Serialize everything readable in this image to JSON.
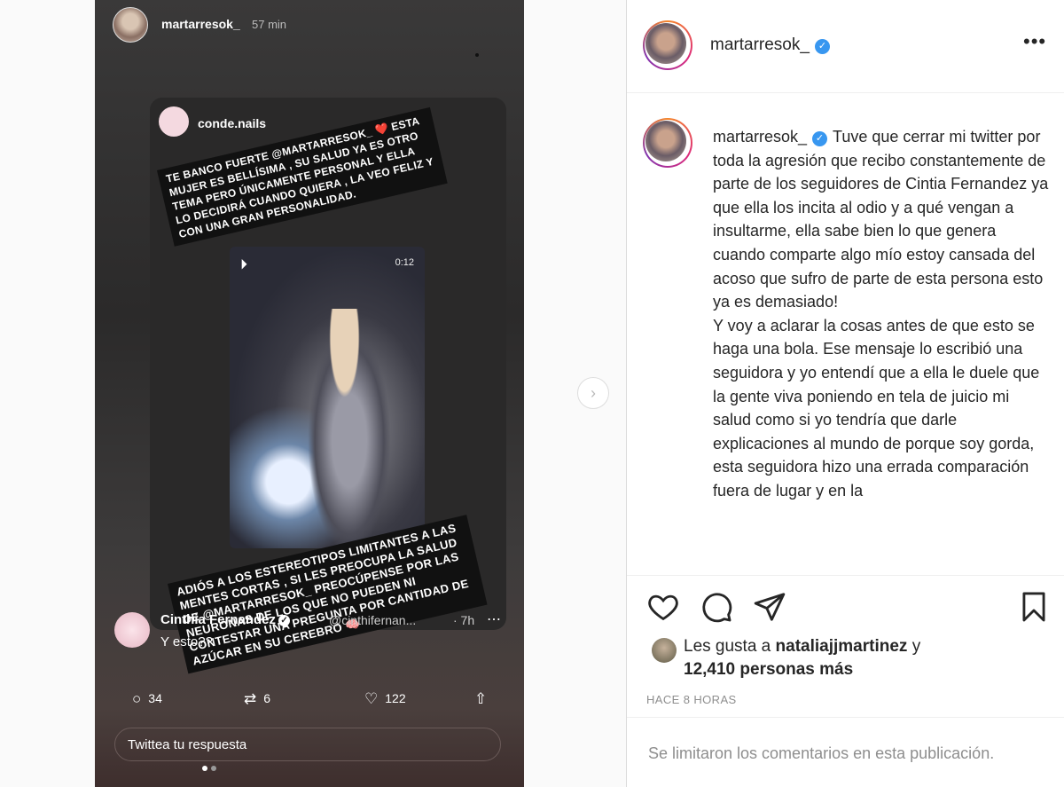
{
  "story": {
    "username": "martarresok_",
    "time": "57 min",
    "card": {
      "username": "conde.nails",
      "sticker_top": "TE BANCO FUERTE @MARTARRESOK_ ❤️ ESTA MUJER ES BELLÍSIMA , SU SALUD YA ES OTRO TEMA PERO ÚNICAMENTE PERSONAL Y ELLA LO DECIDIRÁ CUANDO QUIERA , LA VEO FELIZ Y CON UNA GRAN PERSONALIDAD.",
      "sticker_bottom": "ADIÓS A LOS ESTEREOTIPOS LIMITANTES A LAS MENTES CORTAS , SI LES PREOCUPA LA SALUD DE @MARTARRESOK_ PREOCÚPENSE POR LAS NEURONAS DE LOS QUE NO PUEDEN NI CONTESTAR UNA PREGUNTA POR CANTIDAD DE AZÚCAR EN SU CEREBRO 🧠",
      "video_time": "0:12"
    },
    "tweet": {
      "name": "Cinthia Fernandez",
      "handle": "@cinthifernan...",
      "time": "· 7h",
      "text": "Y esto??",
      "replies": "34",
      "retweets": "6",
      "likes": "122",
      "reply_placeholder": "Twittea tu respuesta"
    }
  },
  "post": {
    "username": "martarresok_",
    "caption_user": "martarresok_",
    "caption": "Tuve que cerrar mi twitter por toda la agresión que recibo constantemente de parte de los seguidores de Cintia Fernandez ya que ella los incita al odio y a qué vengan a insultarme, ella sabe bien lo que genera cuando comparte algo mío estoy cansada del acoso que sufro de parte de esta persona esto ya es demasiado!\nY voy a aclarar la cosas antes de que esto se haga una bola. Ese mensaje lo escribió una seguidora y yo entendí que a ella le duele que la gente viva poniendo en tela de juicio mi salud como si yo tendría que darle explicaciones al mundo de porque soy gorda, esta seguidora hizo una errada comparación fuera de lugar y en la",
    "likes_prefix": "Les gusta a",
    "likes_user": "nataliajjmartinez",
    "likes_mid": "y",
    "likes_count": "12,410 personas más",
    "time_ago": "HACE 8 HORAS",
    "comments_limited": "Se limitaron los comentarios en esta publicación."
  },
  "icons": [
    "verified-icon",
    "more-options-icon",
    "like-heart-icon",
    "comment-icon",
    "share-icon",
    "save-bookmark-icon",
    "next-arrow-icon",
    "reply-icon",
    "retweet-icon",
    "upload-icon"
  ],
  "colors": {
    "verified": "#3897f0",
    "text": "#262626",
    "muted": "#8e8e8e"
  }
}
